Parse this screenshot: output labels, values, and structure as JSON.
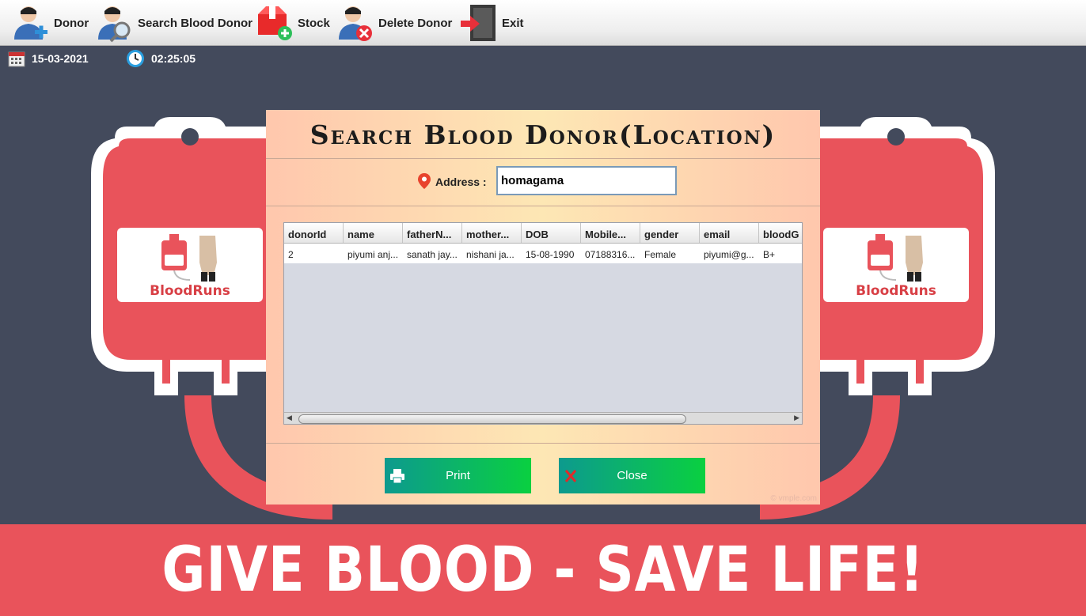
{
  "toolbar": {
    "items": [
      {
        "label": "Donor",
        "icon": "add-user-icon"
      },
      {
        "label": "Search Blood Donor",
        "icon": "search-user-icon"
      },
      {
        "label": "Stock",
        "icon": "stock-box-icon"
      },
      {
        "label": "Delete Donor",
        "icon": "delete-user-icon"
      },
      {
        "label": "Exit",
        "icon": "exit-door-icon"
      }
    ]
  },
  "status": {
    "date": "15-03-2021",
    "time": "02:25:05"
  },
  "background": {
    "logo_text": "BloodRuns",
    "banner": "GIVE BLOOD - SAVE LIFE!",
    "watermark": "© vmple.com"
  },
  "dialog": {
    "title": "Search Blood Donor(Location)",
    "address_label": "Address :",
    "address_value": "homagama",
    "table": {
      "columns": [
        "donorId",
        "name",
        "fatherN...",
        "mother...",
        "DOB",
        "Mobile...",
        "gender",
        "email",
        "bloodG"
      ],
      "rows": [
        [
          "2",
          "piyumi anj...",
          "sanath jay...",
          "nishani ja...",
          "15-08-1990",
          "07188316...",
          "Female",
          "piyumi@g...",
          "B+"
        ]
      ]
    },
    "print_label": "Print",
    "close_label": "Close"
  },
  "colors": {
    "background": "#434a5c",
    "blood_red": "#e9535b",
    "button_gradient_start": "#0d9a8e",
    "button_gradient_end": "#0ad040"
  }
}
